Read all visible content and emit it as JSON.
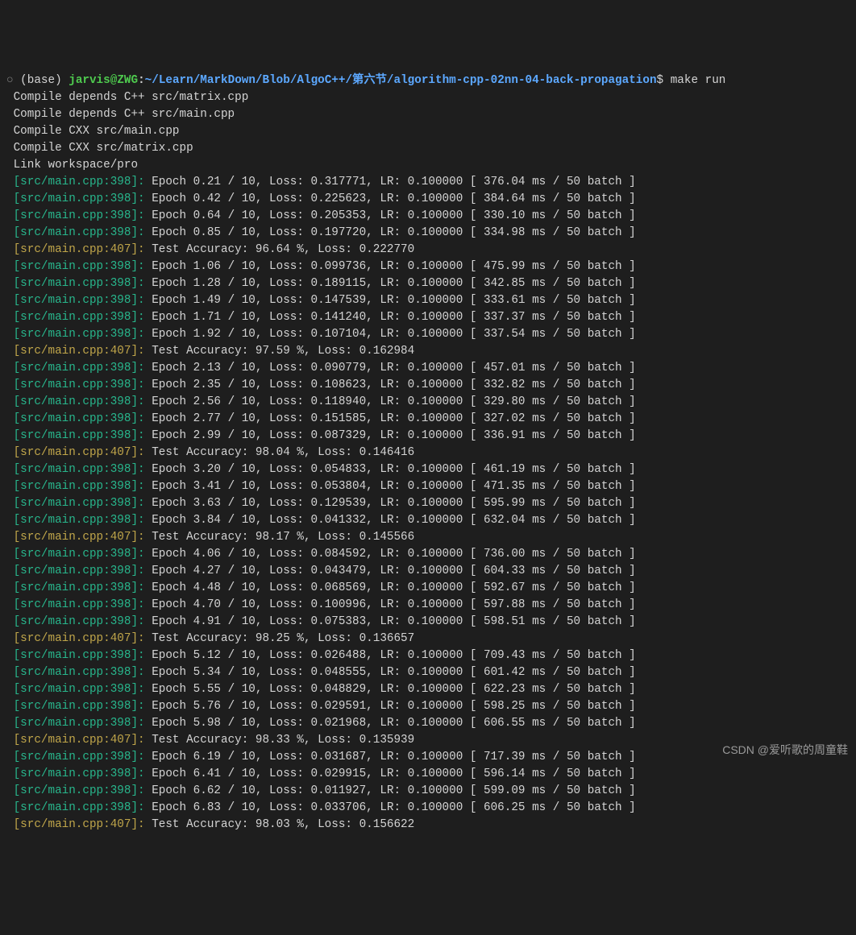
{
  "prompt": {
    "bullet": "○",
    "base": "(base) ",
    "user": "jarvis",
    "at": "@",
    "host": "ZWG",
    "colon": ":",
    "path": "~/Learn/MarkDown/Blob/AlgoC++/第六节/algorithm-cpp-02nn-04-back-propagation",
    "dollar": "$",
    "cmd": " make run"
  },
  "compile_lines": [
    "Compile depends C++ src/matrix.cpp",
    "Compile depends C++ src/main.cpp",
    "Compile CXX src/main.cpp",
    "Compile CXX src/matrix.cpp",
    "Link workspace/pro"
  ],
  "lines": [
    {
      "t": "e",
      "ep": "0.21",
      "loss": "0.317771",
      "lr": "0.100000",
      "ms": "376.04"
    },
    {
      "t": "e",
      "ep": "0.42",
      "loss": "0.225623",
      "lr": "0.100000",
      "ms": "384.64"
    },
    {
      "t": "e",
      "ep": "0.64",
      "loss": "0.205353",
      "lr": "0.100000",
      "ms": "330.10"
    },
    {
      "t": "e",
      "ep": "0.85",
      "loss": "0.197720",
      "lr": "0.100000",
      "ms": "334.98"
    },
    {
      "t": "a",
      "acc": "96.64",
      "loss": "0.222770"
    },
    {
      "t": "e",
      "ep": "1.06",
      "loss": "0.099736",
      "lr": "0.100000",
      "ms": "475.99"
    },
    {
      "t": "e",
      "ep": "1.28",
      "loss": "0.189115",
      "lr": "0.100000",
      "ms": "342.85"
    },
    {
      "t": "e",
      "ep": "1.49",
      "loss": "0.147539",
      "lr": "0.100000",
      "ms": "333.61"
    },
    {
      "t": "e",
      "ep": "1.71",
      "loss": "0.141240",
      "lr": "0.100000",
      "ms": "337.37"
    },
    {
      "t": "e",
      "ep": "1.92",
      "loss": "0.107104",
      "lr": "0.100000",
      "ms": "337.54"
    },
    {
      "t": "a",
      "acc": "97.59",
      "loss": "0.162984"
    },
    {
      "t": "e",
      "ep": "2.13",
      "loss": "0.090779",
      "lr": "0.100000",
      "ms": "457.01"
    },
    {
      "t": "e",
      "ep": "2.35",
      "loss": "0.108623",
      "lr": "0.100000",
      "ms": "332.82"
    },
    {
      "t": "e",
      "ep": "2.56",
      "loss": "0.118940",
      "lr": "0.100000",
      "ms": "329.80"
    },
    {
      "t": "e",
      "ep": "2.77",
      "loss": "0.151585",
      "lr": "0.100000",
      "ms": "327.02"
    },
    {
      "t": "e",
      "ep": "2.99",
      "loss": "0.087329",
      "lr": "0.100000",
      "ms": "336.91"
    },
    {
      "t": "a",
      "acc": "98.04",
      "loss": "0.146416"
    },
    {
      "t": "e",
      "ep": "3.20",
      "loss": "0.054833",
      "lr": "0.100000",
      "ms": "461.19"
    },
    {
      "t": "e",
      "ep": "3.41",
      "loss": "0.053804",
      "lr": "0.100000",
      "ms": "471.35"
    },
    {
      "t": "e",
      "ep": "3.63",
      "loss": "0.129539",
      "lr": "0.100000",
      "ms": "595.99"
    },
    {
      "t": "e",
      "ep": "3.84",
      "loss": "0.041332",
      "lr": "0.100000",
      "ms": "632.04"
    },
    {
      "t": "a",
      "acc": "98.17",
      "loss": "0.145566"
    },
    {
      "t": "e",
      "ep": "4.06",
      "loss": "0.084592",
      "lr": "0.100000",
      "ms": "736.00"
    },
    {
      "t": "e",
      "ep": "4.27",
      "loss": "0.043479",
      "lr": "0.100000",
      "ms": "604.33"
    },
    {
      "t": "e",
      "ep": "4.48",
      "loss": "0.068569",
      "lr": "0.100000",
      "ms": "592.67"
    },
    {
      "t": "e",
      "ep": "4.70",
      "loss": "0.100996",
      "lr": "0.100000",
      "ms": "597.88"
    },
    {
      "t": "e",
      "ep": "4.91",
      "loss": "0.075383",
      "lr": "0.100000",
      "ms": "598.51"
    },
    {
      "t": "a",
      "acc": "98.25",
      "loss": "0.136657"
    },
    {
      "t": "e",
      "ep": "5.12",
      "loss": "0.026488",
      "lr": "0.100000",
      "ms": "709.43"
    },
    {
      "t": "e",
      "ep": "5.34",
      "loss": "0.048555",
      "lr": "0.100000",
      "ms": "601.42"
    },
    {
      "t": "e",
      "ep": "5.55",
      "loss": "0.048829",
      "lr": "0.100000",
      "ms": "622.23"
    },
    {
      "t": "e",
      "ep": "5.76",
      "loss": "0.029591",
      "lr": "0.100000",
      "ms": "598.25"
    },
    {
      "t": "e",
      "ep": "5.98",
      "loss": "0.021968",
      "lr": "0.100000",
      "ms": "606.55"
    },
    {
      "t": "a",
      "acc": "98.33",
      "loss": "0.135939"
    },
    {
      "t": "e",
      "ep": "6.19",
      "loss": "0.031687",
      "lr": "0.100000",
      "ms": "717.39"
    },
    {
      "t": "e",
      "ep": "6.41",
      "loss": "0.029915",
      "lr": "0.100000",
      "ms": "596.14"
    },
    {
      "t": "e",
      "ep": "6.62",
      "loss": "0.011927",
      "lr": "0.100000",
      "ms": "599.09"
    },
    {
      "t": "e",
      "ep": "6.83",
      "loss": "0.033706",
      "lr": "0.100000",
      "ms": "606.25"
    },
    {
      "t": "a",
      "acc": "98.03",
      "loss": "0.156622"
    }
  ],
  "tags": {
    "epoch": "[src/main.cpp:398]:",
    "acc": "[src/main.cpp:407]:"
  },
  "format": {
    "total_epochs": "10",
    "batch": "50"
  },
  "watermark": "CSDN @爱听歌的周童鞋"
}
